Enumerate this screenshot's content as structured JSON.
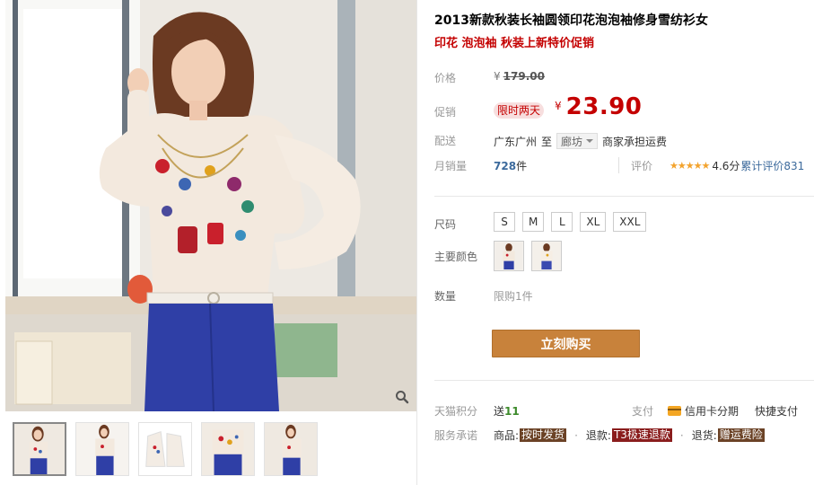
{
  "product": {
    "title": "2013新款秋装长袖圆领印花泡泡袖修身雪纺衫女",
    "subtitle": "印花 泡泡袖 秋装上新特价促销"
  },
  "price": {
    "label": "价格",
    "currency": "¥",
    "original": "179.00"
  },
  "promotion": {
    "label": "促销",
    "badge": "限时两天",
    "currency": "¥",
    "price": "23.90"
  },
  "shipping": {
    "label": "配送",
    "origin": "广东广州",
    "to": "至",
    "destination": "廊坊",
    "note": "商家承担运费"
  },
  "sales": {
    "label": "月销量",
    "count": "728",
    "unit": "件"
  },
  "rating": {
    "label": "评价",
    "stars": "★★★★★",
    "score": "4.6分",
    "count_text": "累计评价831"
  },
  "size": {
    "label": "尺码",
    "options": [
      "S",
      "M",
      "L",
      "XL",
      "XXL"
    ]
  },
  "color": {
    "label": "主要颜色",
    "swatches": [
      "swatch-1",
      "swatch-2"
    ]
  },
  "quantity": {
    "label": "数量",
    "limit": "限购1件"
  },
  "buy_button": "立刻购买",
  "points": {
    "label": "天猫积分",
    "prefix": "送",
    "value": "11"
  },
  "payment": {
    "label": "支付",
    "credit": "信用卡分期",
    "fast": "快捷支付"
  },
  "service": {
    "label": "服务承诺",
    "goods_label": "商品:",
    "goods_tag": "按时发货",
    "refund_label": "退款:",
    "refund_tag": "T3极速退款",
    "return_label": "退货:",
    "return_tag": "赠运费险"
  },
  "icons": {
    "zoom": "magnifier-icon",
    "card": "credit-card-icon"
  },
  "colors": {
    "accent_red": "#c40000",
    "buy_button": "#c8823b",
    "link_blue": "#3c6a9c",
    "star": "#f3a32d",
    "blouse": "#f3e9de",
    "pants": "#2f3fa6",
    "hair": "#6b3a22"
  }
}
